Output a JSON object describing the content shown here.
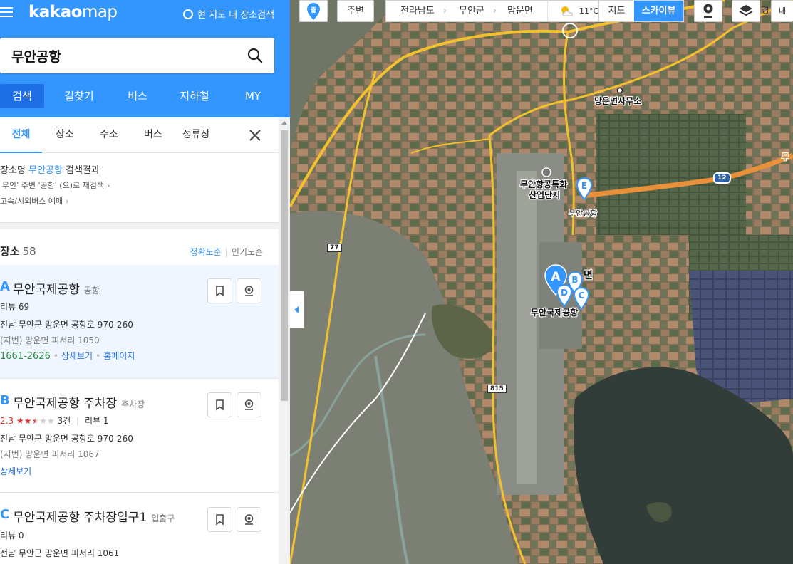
{
  "header": {
    "logo_bold": "kakao",
    "logo_thin": "map",
    "map_search_label": "현 지도 내 장소검색",
    "search_value": "무안공항",
    "nav_tabs": [
      "검색",
      "길찾기",
      "버스",
      "지하철",
      "MY"
    ]
  },
  "subtabs": [
    "전체",
    "장소",
    "주소",
    "버스",
    "정류장"
  ],
  "summary": {
    "prefix": "장소명 ",
    "keyword": "무안공항",
    "suffix": " 검색결과",
    "research": "'무안' 주변 '공항' (으)로 재검색",
    "bus_reserve": "고속/시외버스 예매"
  },
  "places_header": {
    "title": "장소",
    "count": "58",
    "sort_accuracy": "정확도순",
    "sort_popular": "인기도순"
  },
  "places": [
    {
      "marker": "A",
      "name": "무안국제공항",
      "category": "공항",
      "review": "리뷰 69",
      "address": "전남 무안군 망운면 공항로 970-260",
      "jibun": "(지번) 망운면 피서리 1050",
      "phone": "1661-2626",
      "detail": "상세보기",
      "homepage": "홈페이지"
    },
    {
      "marker": "B",
      "name": "무안국제공항 주차장",
      "category": "주차장",
      "rating": "2.3",
      "rating_value": 2.3,
      "rating_count": "3건",
      "review": "리뷰 1",
      "address": "전남 무안군 망운면 공항로 970-260",
      "jibun": "(지번) 망운면 피서리 1067",
      "detail": "상세보기"
    },
    {
      "marker": "C",
      "name": "무안국제공항 주차장입구1",
      "category": "입출구",
      "review": "리뷰 0",
      "address": "전남 무안군 망운면 피서리 1061"
    }
  ],
  "map": {
    "departure_label": "출",
    "nearby_label": "주변",
    "breadcrumb": [
      "전라남도",
      "무안군",
      "망운면"
    ],
    "temperature": "11°C",
    "map_type_map": "지도",
    "map_type_sky": "스카이뷰",
    "extra_label": "경도",
    "extra_label2": "내",
    "labels": {
      "office": "망운면사무소",
      "industrial_1": "무안항공특화",
      "industrial_2": "산업단지",
      "muan_airport": "무안공항",
      "intl_airport": "무안국제공항",
      "town_fragment": "면",
      "route_77": "77",
      "route_815": "815",
      "route_12": "12",
      "edge_fragment": "무"
    },
    "pins": [
      "A",
      "B",
      "C",
      "D",
      "E"
    ],
    "colors": {
      "kakao_blue": "#3396ff",
      "road_yellow": "#f2c12e",
      "road_orange": "#e8913a"
    }
  }
}
